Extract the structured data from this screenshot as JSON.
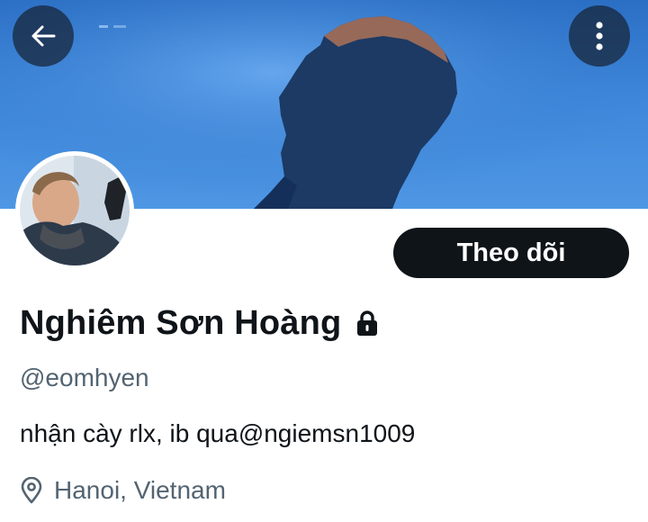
{
  "header": {
    "back_icon": "arrow-left-icon",
    "more_icon": "more-vertical-icon",
    "banner_colors": {
      "sky": "#3d86da",
      "silhouette": "#1c3a64"
    }
  },
  "profile": {
    "display_name": "Nghiêm Sơn Hoàng",
    "protected_icon": "lock-icon",
    "handle": "@eomhyen",
    "bio": "nhận cày rlx, ib qua@ngiemsn1009",
    "location_icon": "location-pin-icon",
    "location": "Hanoi, Vietnam"
  },
  "actions": {
    "follow_label": "Theo dõi",
    "follow_color": "#0f1419"
  }
}
